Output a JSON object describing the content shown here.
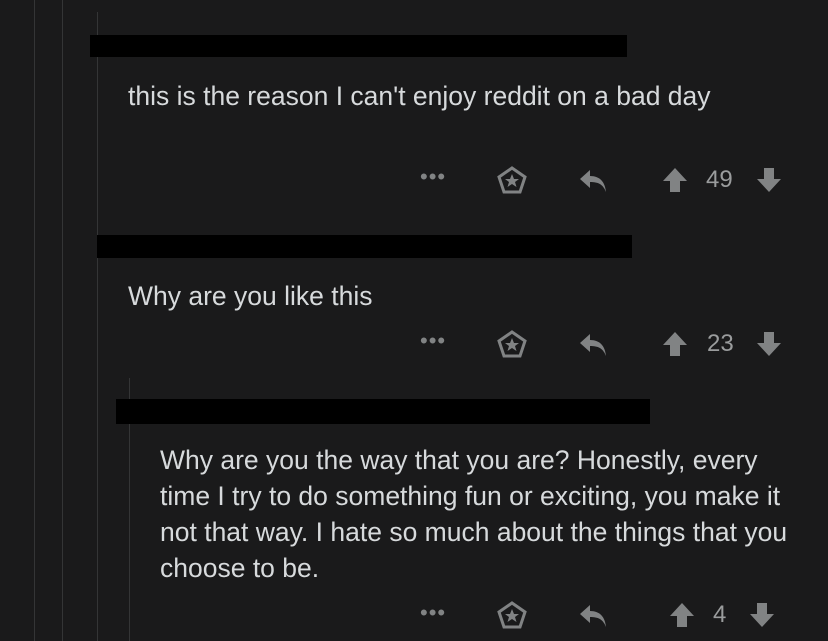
{
  "theme": {
    "background": "#1a1a1b",
    "text": "#d7dadc",
    "icon": "#818384",
    "redaction": "#000000"
  },
  "comments": [
    {
      "author": "",
      "body": "this is the reason I can't enjoy reddit on a bad day",
      "score": "49",
      "more_label": "•••"
    },
    {
      "author": "",
      "body": "Why are you like this",
      "score": "23",
      "more_label": "•••"
    },
    {
      "author": "",
      "body": "Why are you the way that you are? Honestly, every time I try to do something fun or exciting, you make it not that way. I hate so much about the things that you choose to be.",
      "score": "4",
      "more_label": "•••"
    }
  ],
  "icons": {
    "more": "more-options-icon",
    "award": "award-icon",
    "reply": "reply-icon",
    "upvote": "upvote-arrow-icon",
    "downvote": "downvote-arrow-icon"
  }
}
